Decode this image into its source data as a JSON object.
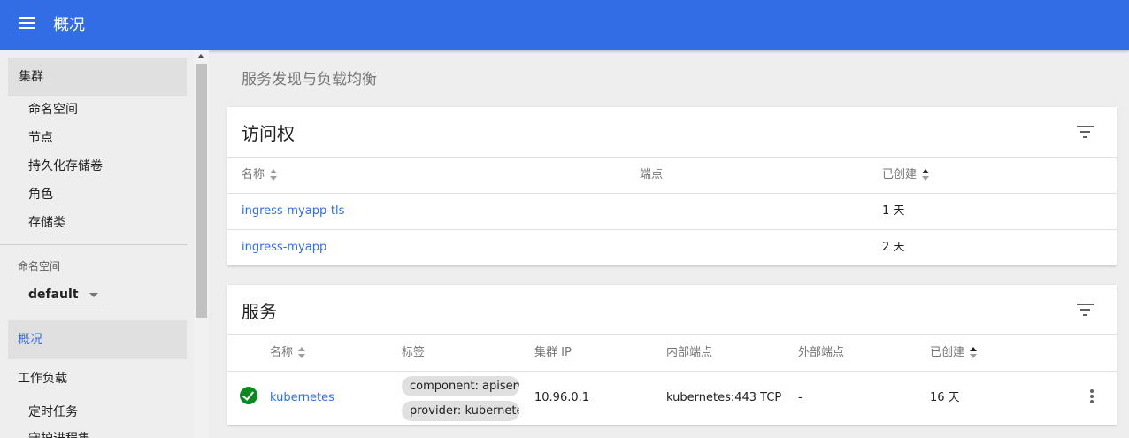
{
  "header": {
    "title": "概况"
  },
  "sidebar": {
    "cluster_section": "集群",
    "cluster_items": [
      "命名空间",
      "节点",
      "持久化存储卷",
      "角色",
      "存储类"
    ],
    "namespace_label": "命名空间",
    "namespace_value": "default",
    "overview": "概况",
    "workloads": "工作负载",
    "workload_items": [
      "定时任务",
      "守护进程集"
    ]
  },
  "main": {
    "heading": "服务发现与负载均衡",
    "ingress": {
      "title": "访问权",
      "columns": [
        "名称",
        "端点",
        "已创建"
      ],
      "rows": [
        {
          "name": "ingress-myapp-tls",
          "endpoints": "",
          "created": "1 天"
        },
        {
          "name": "ingress-myapp",
          "endpoints": "",
          "created": "2 天"
        }
      ]
    },
    "services": {
      "title": "服务",
      "columns": [
        "名称",
        "标签",
        "集群 IP",
        "内部端点",
        "外部端点",
        "已创建"
      ],
      "rows": [
        {
          "status": "running",
          "name": "kubernetes",
          "labels": [
            "component: apiserver",
            "provider: kubernetes"
          ],
          "cluster_ip": "10.96.0.1",
          "internal_endpoints": "kubernetes:443 TCP",
          "external_endpoints": "-",
          "created": "16 天"
        }
      ]
    }
  },
  "colors": {
    "primary": "#326de6",
    "status_ok": "#0a8a1e"
  }
}
